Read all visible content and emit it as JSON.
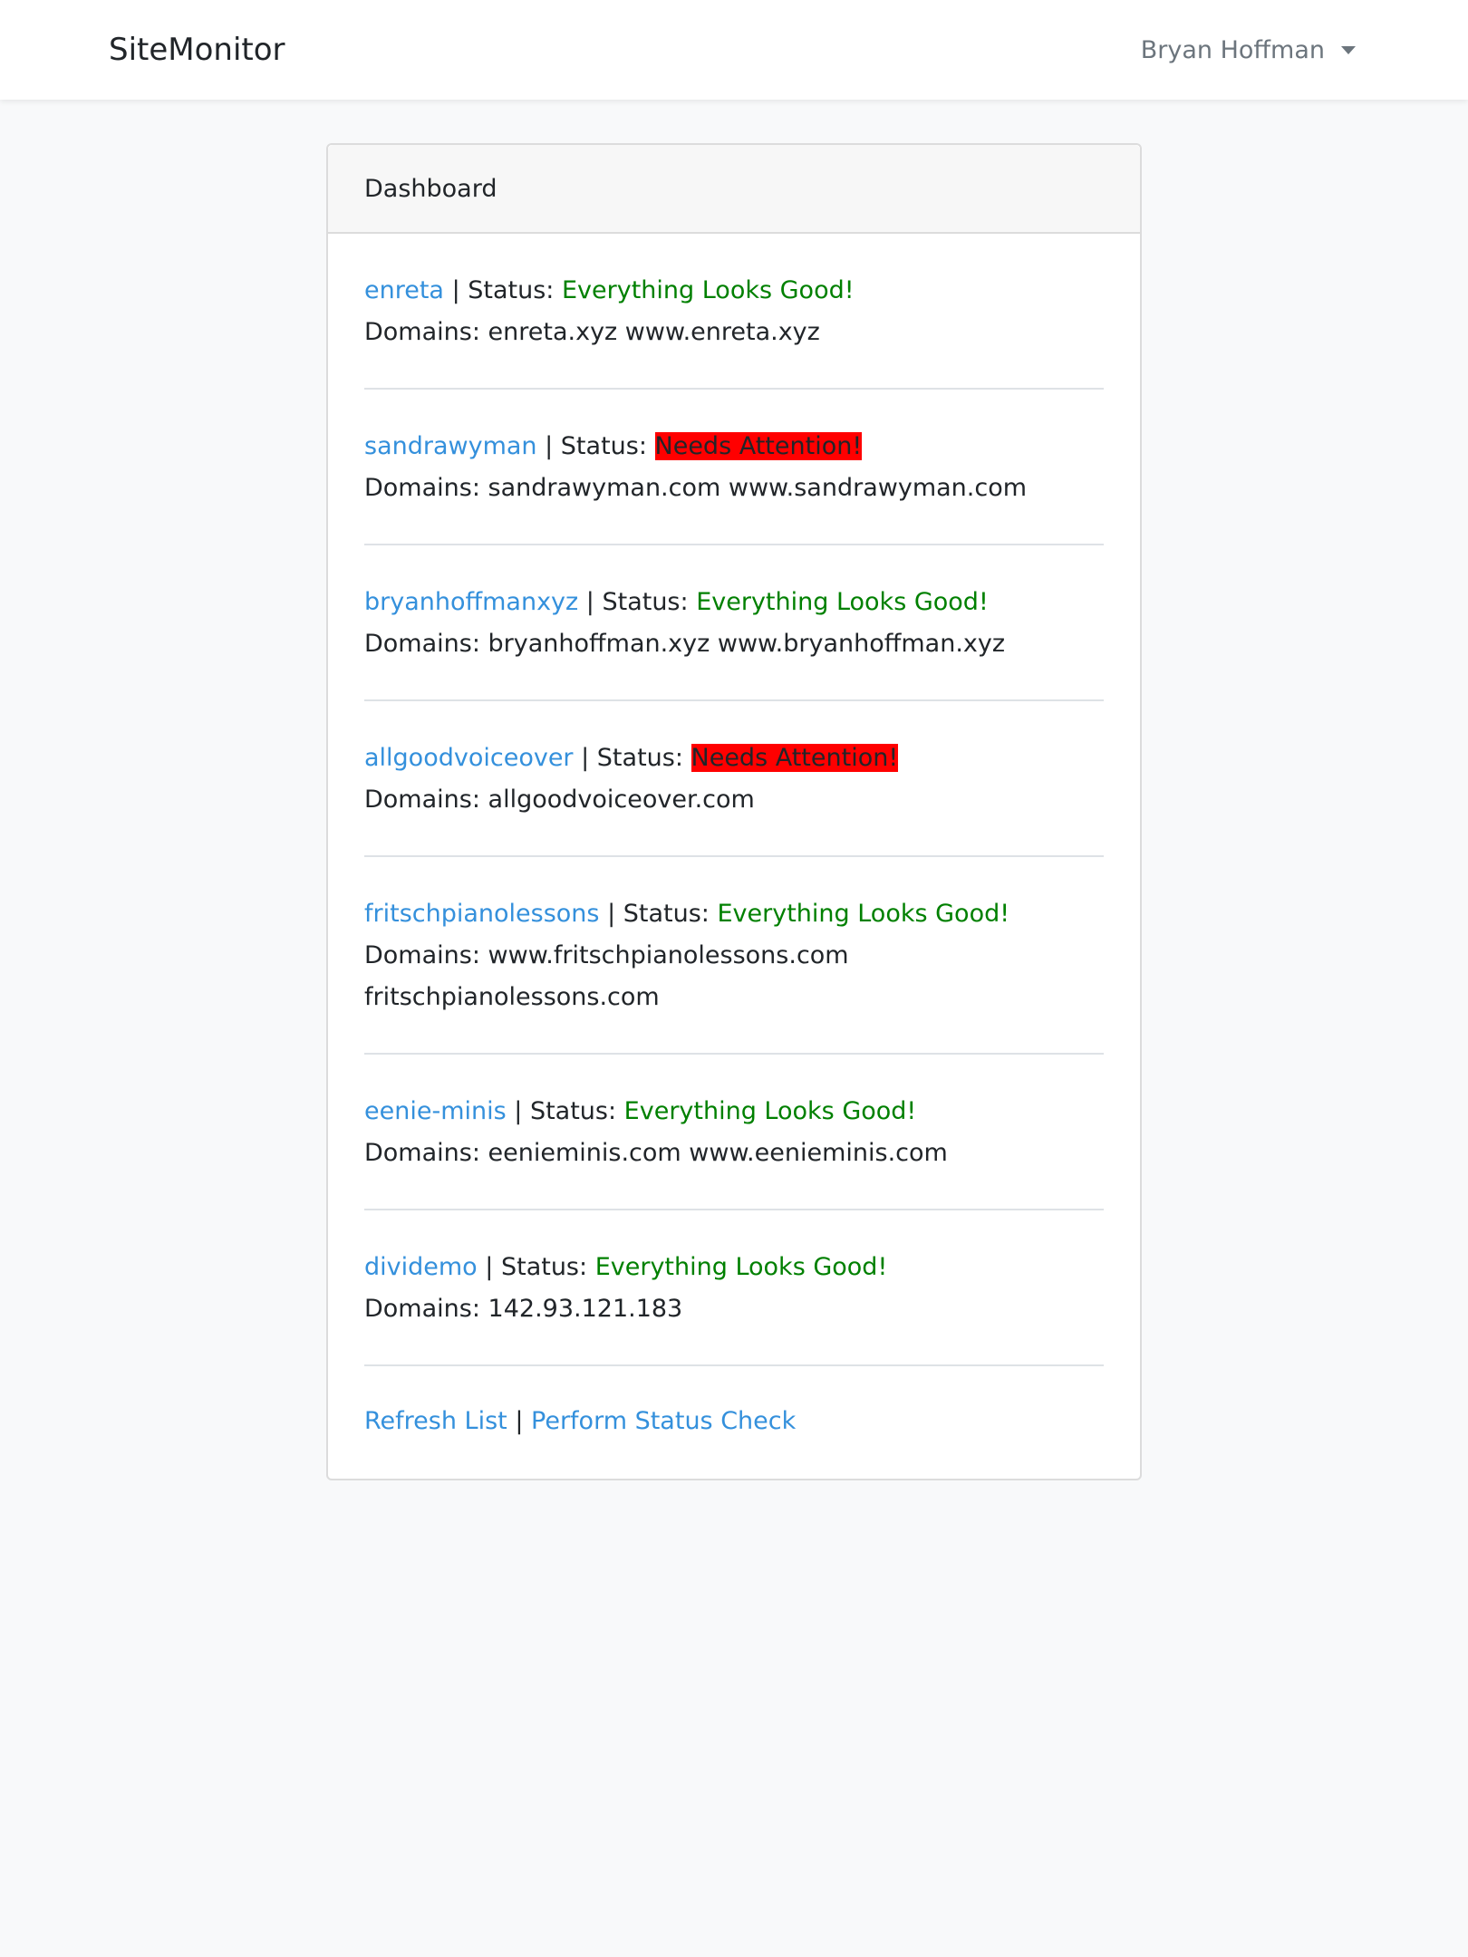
{
  "app": {
    "brand": "SiteMonitor",
    "user_name": "Bryan Hoffman"
  },
  "card": {
    "title": "Dashboard"
  },
  "labels": {
    "status_prefix": "| Status: ",
    "domains_prefix": "Domains: ",
    "separator": " | "
  },
  "sites": [
    {
      "name": "enreta",
      "status": "Everything Looks Good!",
      "status_type": "good",
      "domains": "enreta.xyz www.enreta.xyz"
    },
    {
      "name": "sandrawyman",
      "status": "Needs Attention!",
      "status_type": "bad",
      "domains": "sandrawyman.com www.sandrawyman.com"
    },
    {
      "name": "bryanhoffmanxyz",
      "status": "Everything Looks Good!",
      "status_type": "good",
      "domains": "bryanhoffman.xyz www.bryanhoffman.xyz"
    },
    {
      "name": "allgoodvoiceover",
      "status": "Needs Attention!",
      "status_type": "bad",
      "domains": "allgoodvoiceover.com"
    },
    {
      "name": "fritschpianolessons",
      "status": "Everything Looks Good!",
      "status_type": "good",
      "domains": "www.fritschpianolessons.com fritschpianolessons.com"
    },
    {
      "name": "eenie-minis",
      "status": "Everything Looks Good!",
      "status_type": "good",
      "domains": "eenieminis.com www.eenieminis.com"
    },
    {
      "name": "dividemo",
      "status": "Everything Looks Good!",
      "status_type": "good",
      "domains": "142.93.121.183"
    }
  ],
  "actions": {
    "refresh_label": "Refresh List",
    "check_label": "Perform Status Check"
  },
  "colors": {
    "link": "#3490dc",
    "good": "#008000",
    "bad_bg": "#ff0000"
  }
}
